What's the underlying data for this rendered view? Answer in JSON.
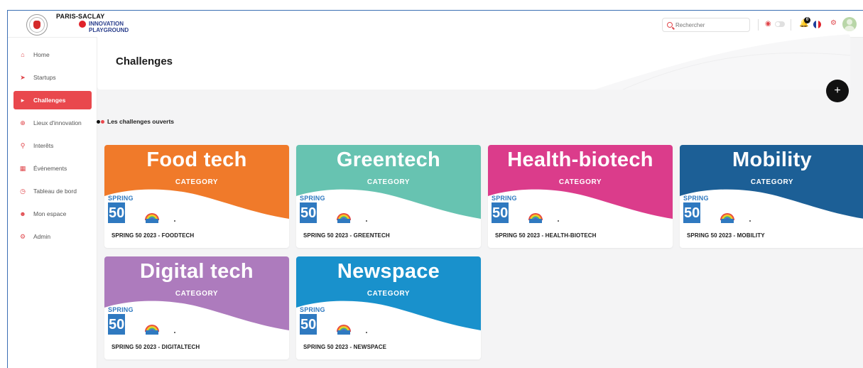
{
  "brand": {
    "line1": "PARIS-SACLAY",
    "line2": "INNOVATION",
    "line3": "PLAYGROUND",
    "seal_text": "UNIVERSITÉ PARIS-SACLAY"
  },
  "header": {
    "search_placeholder": "Rechercher",
    "notifications_count": "0",
    "language": "fr",
    "icons": [
      "search-icon",
      "eye-off-icon",
      "toggle-switch",
      "bell-icon",
      "flag-fr-icon",
      "gear-icon",
      "avatar"
    ]
  },
  "sidebar": {
    "items": [
      {
        "label": "Home",
        "icon": "home-icon",
        "active": false
      },
      {
        "label": "Startups",
        "icon": "rocket-icon",
        "active": false
      },
      {
        "label": "Challenges",
        "icon": "megaphone-icon",
        "active": true
      },
      {
        "label": "Lieux d'innovation",
        "icon": "globe-icon",
        "active": false
      },
      {
        "label": "Interêts",
        "icon": "search-icon",
        "active": false
      },
      {
        "label": "Événements",
        "icon": "calendar-icon",
        "active": false
      },
      {
        "label": "Tableau de bord",
        "icon": "clock-icon",
        "active": false
      },
      {
        "label": "Mon espace",
        "icon": "user-icon",
        "active": false
      },
      {
        "label": "Admin",
        "icon": "gear-icon",
        "active": false
      }
    ]
  },
  "main": {
    "title": "Challenges",
    "add_button": "+",
    "section_title": "Les challenges ouverts",
    "spring_word": "SPRING",
    "spring_number": "50",
    "cards": [
      {
        "category": "Food tech",
        "subtitle": "CATEGORY",
        "title": "SPRING 50 2023 - FOODTECH",
        "color": "#f07a2a"
      },
      {
        "category": "Greentech",
        "subtitle": "CATEGORY",
        "title": "SPRING 50 2023 - GREENTECH",
        "color": "#67c3b1"
      },
      {
        "category": "Health-biotech",
        "subtitle": "CATEGORY",
        "title": "SPRING 50 2023 - HEALTH-BIOTECH",
        "color": "#db3c8b"
      },
      {
        "category": "Mobility",
        "subtitle": "CATEGORY",
        "title": "SPRING 50 2023 - MOBILITY",
        "color": "#1c5f96"
      },
      {
        "category": "Digital tech",
        "subtitle": "CATEGORY",
        "title": "SPRING 50 2023 - DIGITALTECH",
        "color": "#ad7bbd"
      },
      {
        "category": "Newspace",
        "subtitle": "CATEGORY",
        "title": "SPRING 50 2023 - NEWSPACE",
        "color": "#1991cc"
      }
    ]
  },
  "colors": {
    "accent": "#e9484d",
    "spring_blue": "#2f79c0",
    "frame_border": "#3c6fb4"
  }
}
